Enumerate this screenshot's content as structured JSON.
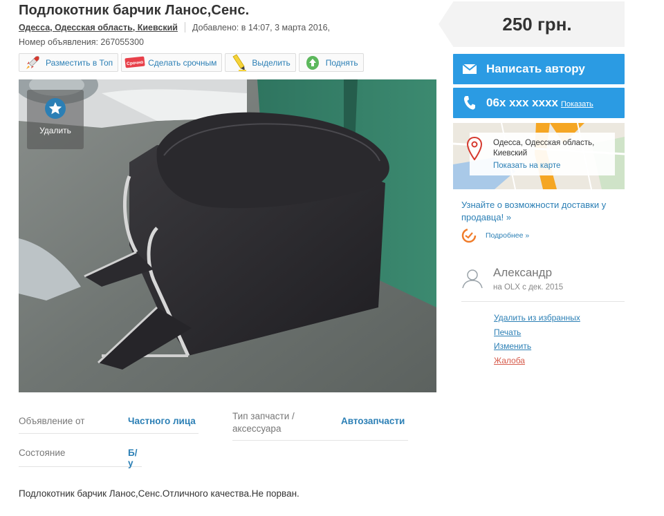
{
  "listing": {
    "title": "Подлокотник барчик Ланос,Сенс.",
    "location": "Одесса, Одесская область, Киевский",
    "added": "Добавлено: в 14:07, 3 марта 2016,",
    "ad_number": "Номер объявления: 267055300",
    "description": "Подлокотник барчик Ланос,Сенс.Отличного качества.Не порван."
  },
  "actions": [
    {
      "label": "Разместить в Топ",
      "icon": "rocket-icon"
    },
    {
      "label": "Сделать срочным",
      "icon": "urgent-tag-icon",
      "icon_text": "Срочно"
    },
    {
      "label": "Выделить",
      "icon": "highlighter-icon"
    },
    {
      "label": "Поднять",
      "icon": "arrow-up-icon"
    }
  ],
  "photo": {
    "favorite_label": "Удалить",
    "icon": "star-icon"
  },
  "params": [
    {
      "label": "Объявление от",
      "value": "Частного лица"
    },
    {
      "label": "Тип запчасти / аксессуара",
      "value": "Автозапчасти"
    },
    {
      "label": "Состояние",
      "value": "Б/у"
    }
  ],
  "sidebar": {
    "price": "250 грн.",
    "write_button": "Написать автору",
    "phone": "06x xxx xxxx",
    "phone_show": "Показать",
    "map_address": "Одесса, Одесская область, Киевский",
    "map_link": "Показать на карте",
    "delivery_text": "Узнайте о возможности доставки у продавца! »",
    "delivery_more": "Подробнее »",
    "seller_name": "Александр",
    "seller_since": "на OLX с дек. 2015",
    "links": {
      "remove_fav": "Удалить из избранных",
      "print": "Печать",
      "edit": "Изменить",
      "report": "Жалоба"
    }
  },
  "colors": {
    "accent": "#2b9be3",
    "link": "#2b7fb5",
    "report": "#d65a4a"
  }
}
